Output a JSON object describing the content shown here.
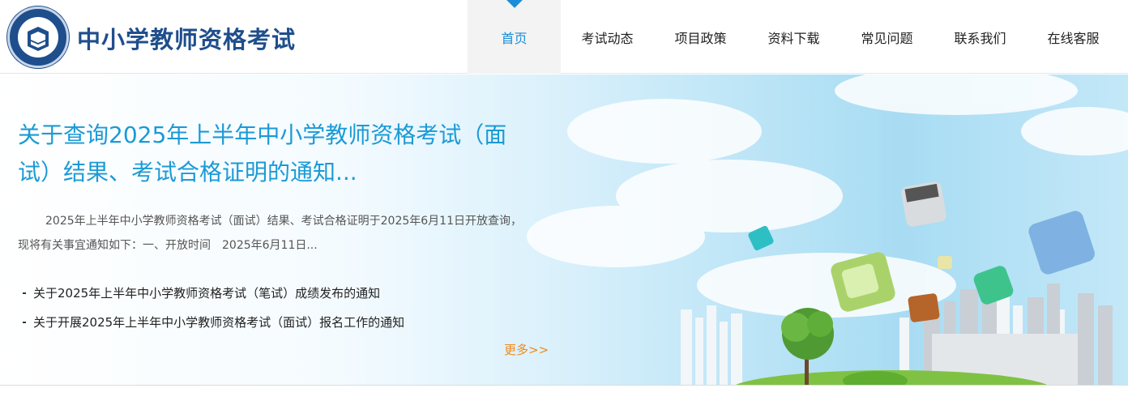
{
  "header": {
    "site_title": "中小学教师资格考试",
    "logo_icon": "exam-seal-emblem"
  },
  "nav": {
    "items": [
      {
        "label": "首页",
        "active": true
      },
      {
        "label": "考试动态"
      },
      {
        "label": "项目政策"
      },
      {
        "label": "资料下载"
      },
      {
        "label": "常见问题"
      },
      {
        "label": "联系我们"
      },
      {
        "label": "在线客服"
      }
    ]
  },
  "banner": {
    "headline": "关于查询2025年上半年中小学教师资格考试（面试）结果、考试合格证明的通知...",
    "summary": "2025年上半年中小学教师资格考试（面试）结果、考试合格证明于2025年6月11日开放查询，现将有关事宜通知如下：一、开放时间　2025年6月11日...",
    "links": [
      "关于2025年上半年中小学教师资格考试（笔试）成绩发布的通知",
      "关于开展2025年上半年中小学教师资格考试（面试）报名工作的通知"
    ],
    "more_label": "更多>>"
  },
  "colors": {
    "brand_blue": "#1f4e8c",
    "accent_blue": "#1b9ad6",
    "more_orange": "#f08a1c"
  }
}
